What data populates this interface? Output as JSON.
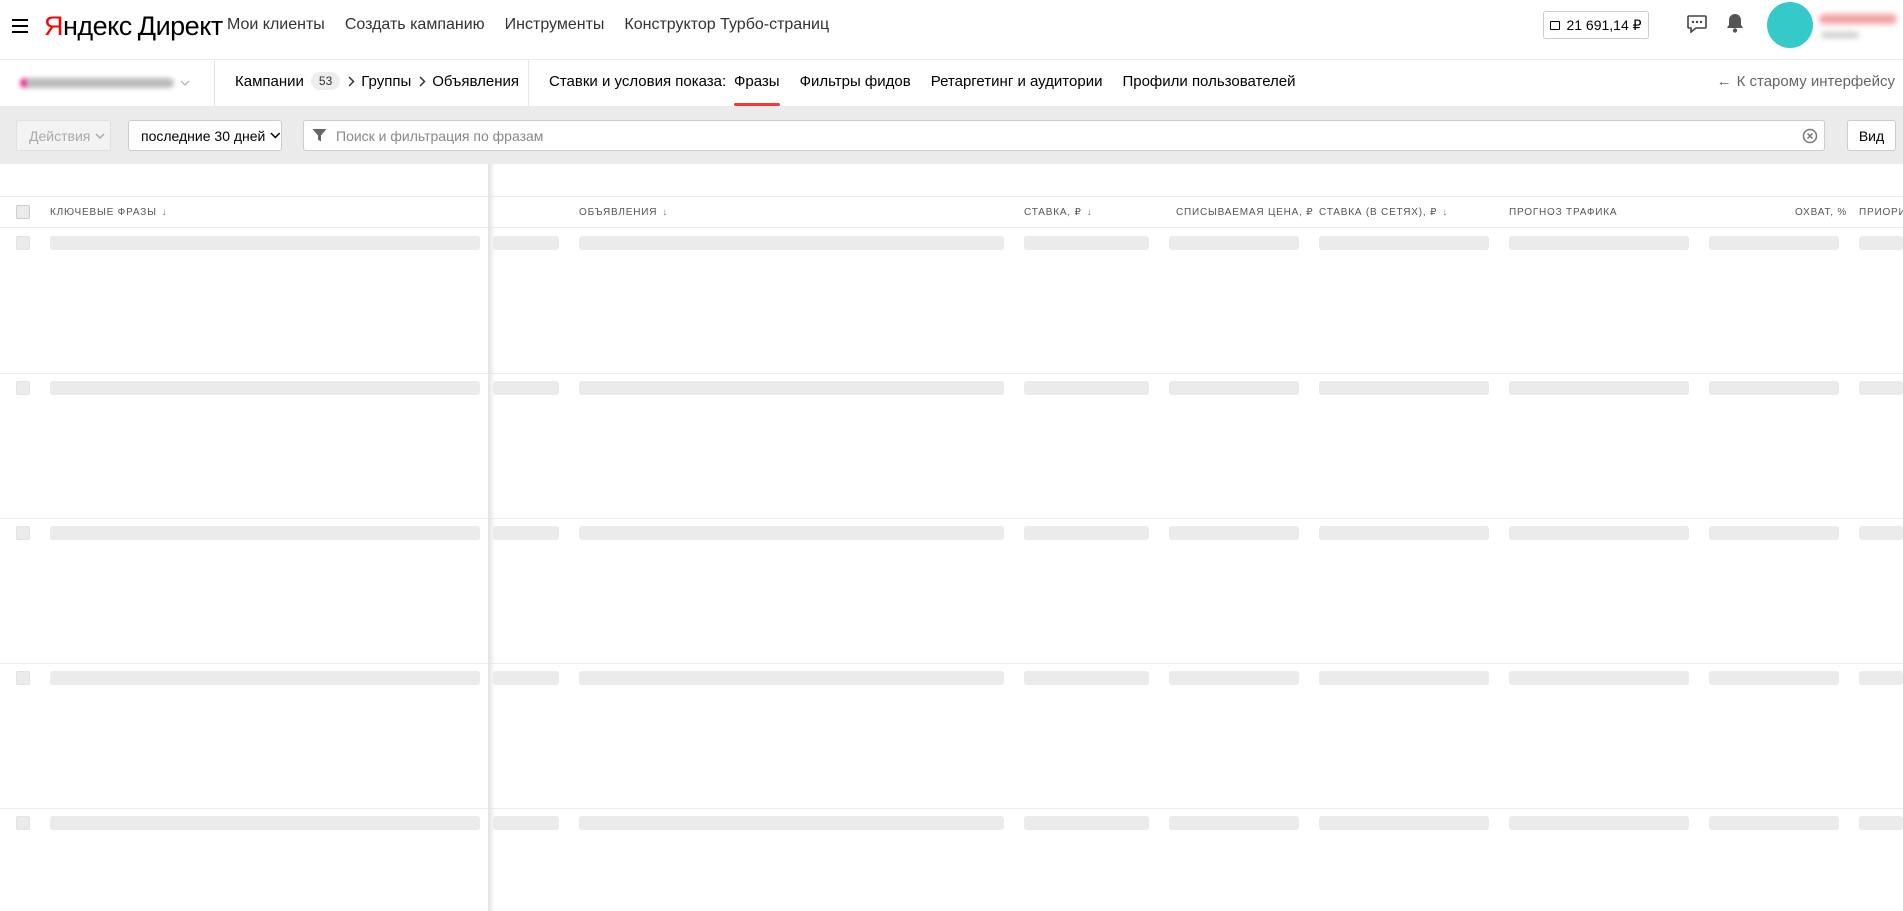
{
  "header": {
    "logo_brand_red": "Я",
    "logo_brand_rest": "ндекс",
    "logo_product": "Директ",
    "nav": [
      "Мои клиенты",
      "Создать кампанию",
      "Инструменты",
      "Конструктор Турбо-страниц"
    ],
    "balance": "21 691,14 ₽"
  },
  "subnav": {
    "breadcrumbs": {
      "campaigns": "Кампании",
      "campaigns_count": "53",
      "groups": "Группы",
      "ads": "Объявления"
    },
    "tabs_label": "Ставки и условия показа:",
    "tabs": [
      {
        "label": "Фразы",
        "active": true
      },
      {
        "label": "Фильтры фидов",
        "active": false
      },
      {
        "label": "Ретаргетинг и аудитории",
        "active": false
      },
      {
        "label": "Профили пользователей",
        "active": false
      }
    ],
    "back_link": "К старому интерфейсу"
  },
  "toolbar": {
    "actions_label": "Действия",
    "period_label": "последние 30 дней",
    "search_placeholder": "Поиск и фильтрация по фразам",
    "view_label": "Вид"
  },
  "table": {
    "columns": [
      {
        "label": "Ключевые фразы",
        "sortable": true
      },
      {
        "label": "Объявления",
        "sortable": true
      },
      {
        "label": "Ставка, ₽",
        "sortable": true
      },
      {
        "label": "Списываемая цена, ₽",
        "sortable": false
      },
      {
        "label": "Ставка (в сетях), ₽",
        "sortable": true
      },
      {
        "label": "Прогноз трафика",
        "sortable": false
      },
      {
        "label": "Охват, %",
        "sortable": false
      },
      {
        "label": "Приори",
        "sortable": false
      }
    ],
    "loading_rows": 5
  },
  "colors": {
    "accent_red": "#ff3333",
    "avatar": "#35c9c9",
    "skeleton": "#ebebeb",
    "toolbar_bg": "#ebebeb"
  }
}
